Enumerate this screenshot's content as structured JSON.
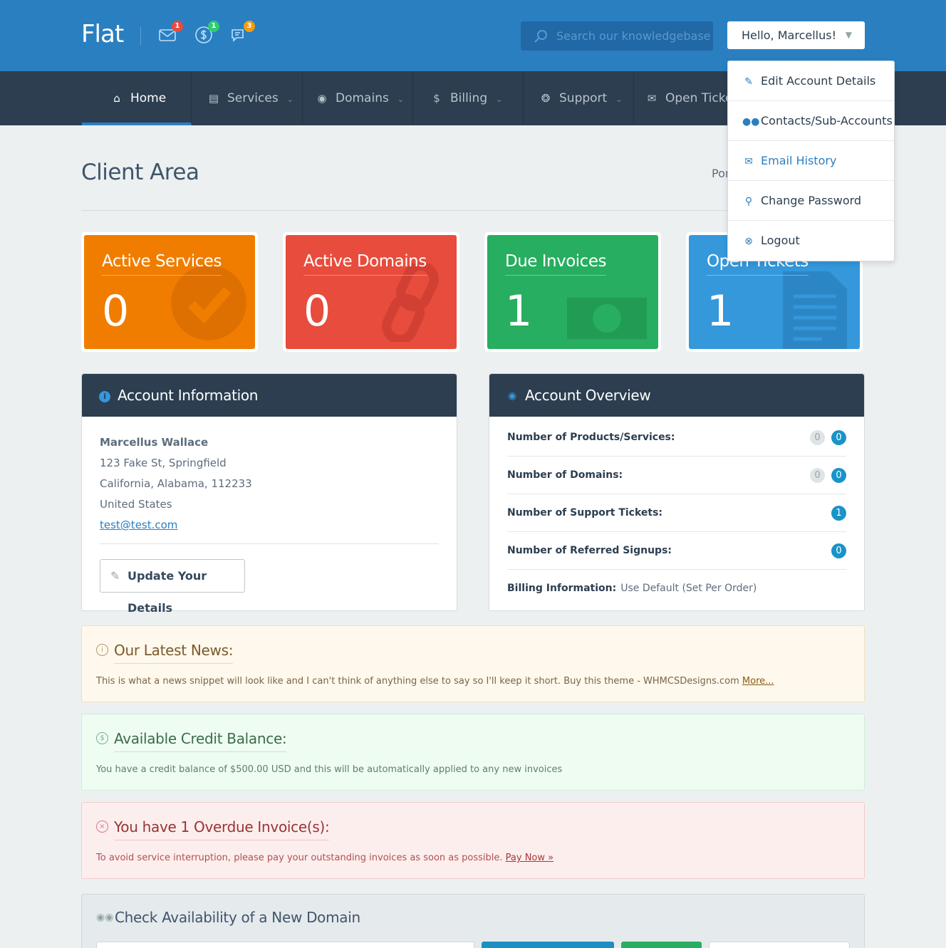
{
  "header": {
    "logo": "Flat",
    "notifications": [
      {
        "icon": "envelope-icon",
        "count": "1",
        "color": "#e74c3c"
      },
      {
        "icon": "dollar-icon",
        "count": "1",
        "color": "#2ecc71"
      },
      {
        "icon": "chat-icon",
        "count": "3",
        "color": "#f39c12"
      }
    ],
    "search_placeholder": "Search our knowledgebase",
    "greeting": "Hello, Marcellus!"
  },
  "nav": {
    "items": [
      {
        "label": "Home",
        "icon": "home-icon"
      },
      {
        "label": "Services",
        "icon": "services-icon"
      },
      {
        "label": "Domains",
        "icon": "binoculars-icon"
      },
      {
        "label": "Billing",
        "icon": "dollar-icon"
      },
      {
        "label": "Support",
        "icon": "lifebuoy-icon"
      },
      {
        "label": "Open Ticke",
        "icon": "envelope-icon"
      }
    ]
  },
  "dropdown": {
    "items": [
      {
        "label": "Edit Account Details",
        "icon": "pencil-icon"
      },
      {
        "label": "Contacts/Sub-Accounts",
        "icon": "users-icon"
      },
      {
        "label": "Email History",
        "icon": "envelope-icon"
      },
      {
        "label": "Change Password",
        "icon": "key-icon"
      },
      {
        "label": "Logout",
        "icon": "close-circle-icon"
      }
    ]
  },
  "page": {
    "title": "Client Area",
    "portal_text": "Por"
  },
  "tiles": [
    {
      "title": "Active Services",
      "value": "0",
      "color": "#f07d00"
    },
    {
      "title": "Active Domains",
      "value": "0",
      "color": "#e74c3c"
    },
    {
      "title": "Due Invoices",
      "value": "1",
      "color": "#27ae60"
    },
    {
      "title": "Open Tickets",
      "value": "1",
      "color": "#3498db"
    }
  ],
  "account_info": {
    "heading": "Account Information",
    "name": "Marcellus Wallace",
    "address1": "123 Fake St, Springfield",
    "address2": "California, Alabama, 112233",
    "country": "United States",
    "email": "test@test.com",
    "update_button": "Update Your Details"
  },
  "account_overview": {
    "heading": "Account Overview",
    "rows": [
      {
        "label": "Number of Products/Services:",
        "gray": "0",
        "blue": "0"
      },
      {
        "label": "Number of Domains:",
        "gray": "0",
        "blue": "0"
      },
      {
        "label": "Number of Support Tickets:",
        "blue": "1"
      },
      {
        "label": "Number of Referred Signups:",
        "blue": "0"
      }
    ],
    "billing_label": "Billing Information:",
    "billing_value": "Use Default (Set Per Order)"
  },
  "news": {
    "title": "Our Latest News:",
    "text": "This is what a news snippet will look like and I can't think of anything else to say so I'll keep it short. Buy this theme - WHMCSDesigns.com",
    "link": "More..."
  },
  "credit": {
    "title": "Available Credit Balance:",
    "text": "You have a credit balance of $500.00 USD and this will be automatically applied to any new invoices"
  },
  "overdue": {
    "title": "You have 1 Overdue Invoice(s):",
    "text": "To avoid service interruption, please pay your outstanding invoices as soon as possible.",
    "link": "Pay Now »"
  },
  "domain_check": {
    "title": "Check Availability of a New Domain"
  }
}
